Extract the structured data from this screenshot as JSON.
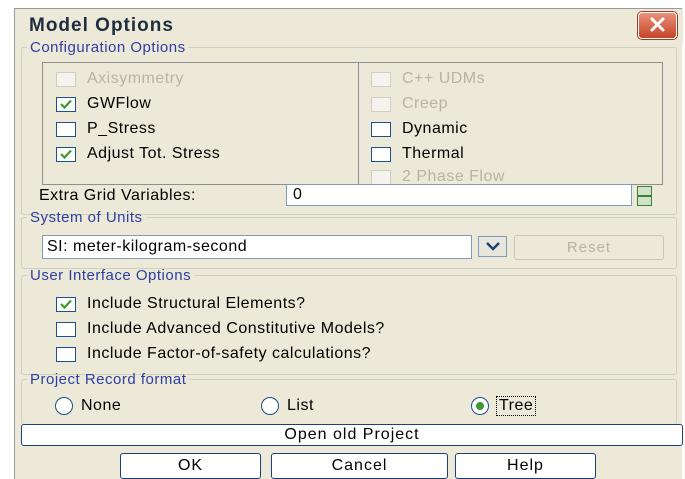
{
  "dialog": {
    "title": "Model Options"
  },
  "configuration": {
    "legend": "Configuration Options",
    "left_checks": [
      {
        "label": "Axisymmetry",
        "checked": false,
        "enabled": false
      },
      {
        "label": "GWFlow",
        "checked": true,
        "enabled": true
      },
      {
        "label": "P_Stress",
        "checked": false,
        "enabled": true
      },
      {
        "label": "Adjust Tot. Stress",
        "checked": true,
        "enabled": true
      }
    ],
    "right_checks": [
      {
        "label": "C++ UDMs",
        "checked": false,
        "enabled": false
      },
      {
        "label": "Creep",
        "checked": false,
        "enabled": false
      },
      {
        "label": "Dynamic",
        "checked": false,
        "enabled": true
      },
      {
        "label": "Thermal",
        "checked": false,
        "enabled": true
      },
      {
        "label": "2 Phase Flow",
        "checked": false,
        "enabled": false
      }
    ],
    "extra_grid_label": "Extra Grid Variables:",
    "extra_grid_value": "0"
  },
  "units": {
    "legend": "System of Units",
    "selected": "SI: meter-kilogram-second",
    "reset_label": "Reset"
  },
  "ui_options": {
    "legend": "User Interface Options",
    "checks": [
      {
        "label": "Include Structural Elements?",
        "checked": true
      },
      {
        "label": "Include Advanced Constitutive Models?",
        "checked": false
      },
      {
        "label": "Include Factor-of-safety calculations?",
        "checked": false
      }
    ]
  },
  "record": {
    "legend": "Project Record format",
    "options": [
      {
        "label": "None",
        "selected": false
      },
      {
        "label": "List",
        "selected": false
      },
      {
        "label": "Tree",
        "selected": true
      }
    ]
  },
  "buttons": {
    "open_old_project": "Open old Project",
    "ok": "OK",
    "cancel": "Cancel",
    "help": "Help"
  },
  "colors": {
    "accent_check": "#3a9a2e",
    "legend_text": "#2b3fa3",
    "close_button": "#c4452a"
  }
}
